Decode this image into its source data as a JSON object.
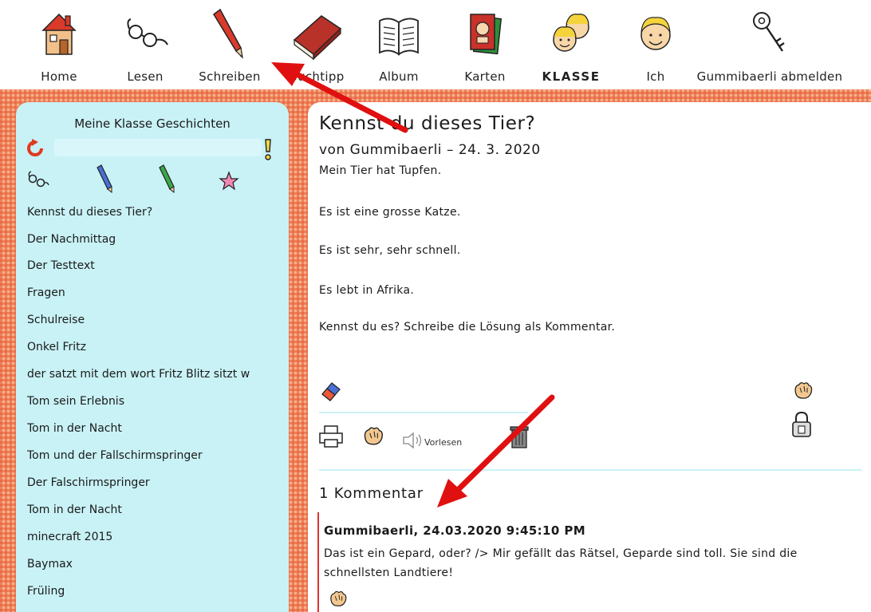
{
  "nav": {
    "items": [
      {
        "label": "Home",
        "icon": "house-icon"
      },
      {
        "label": "Lesen",
        "icon": "glasses-icon"
      },
      {
        "label": "Schreiben",
        "icon": "pencil-icon"
      },
      {
        "label": "Buchtipp",
        "icon": "book-icon"
      },
      {
        "label": "Album",
        "icon": "open-book-icon"
      },
      {
        "label": "Karten",
        "icon": "cards-icon"
      },
      {
        "label": "KLASSE",
        "icon": "class-kids-icon"
      },
      {
        "label": "Ich",
        "icon": "kid-face-icon"
      },
      {
        "label": "Gummibaerli abmelden",
        "icon": "key-icon"
      }
    ]
  },
  "sidebar": {
    "title": "Meine Klasse Geschichten",
    "stories": [
      "Kennst du dieses Tier?",
      "Der Nachmittag",
      "Der Testtext",
      "Fragen",
      "Schulreise",
      "Onkel Fritz",
      "der satzt mit dem wort Fritz Blitz sitzt w",
      "Tom sein Erlebnis",
      "Tom in der Nacht",
      "Tom und der Fallschirmspringer",
      "Der Falschirmspringer",
      "Tom in der Nacht",
      "minecraft 2015",
      "Baymax",
      "Früling"
    ]
  },
  "story": {
    "title": "Kennst du dieses Tier?",
    "meta": "von Gummibaerli – 24. 3. 2020",
    "lines": [
      "Mein Tier hat Tupfen.",
      "Es ist eine grosse Katze.",
      "Es ist sehr, sehr schnell.",
      "Es lebt in Afrika.",
      "Kennst du es? Schreibe die Lösung als Kommentar."
    ],
    "vorlesen": "Vorlesen"
  },
  "comments": {
    "header": "1 Kommentar",
    "items": [
      {
        "author": "Gummibaerli, 24.03.2020 9:45:10 PM",
        "text": "Das ist ein Gepard, oder? /> Mir gefällt das Rätsel, Geparde sind toll. Sie sind die schnellsten Landtiere!"
      }
    ]
  },
  "colors": {
    "sidebar_bg": "#c9f2f6",
    "checker": "#f6b08a",
    "annotation_arrow": "#e01010",
    "comment_border": "#e03030"
  }
}
